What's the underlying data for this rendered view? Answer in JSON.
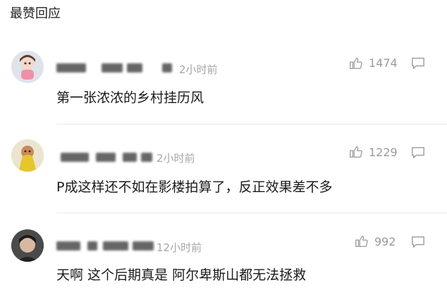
{
  "section": {
    "title": "最赞回应"
  },
  "comments": [
    {
      "time": "2小时前",
      "likes": "1474",
      "text": "第一张浓浓的乡村挂历风"
    },
    {
      "time": "2小时前",
      "likes": "1229",
      "text": "P成这样还不如在影楼拍算了，反正效果差不多"
    },
    {
      "time": "12小时前",
      "likes": "992",
      "text": "天啊 这个后期真是 阿尔卑斯山都无法拯救"
    }
  ],
  "icons": {
    "like": "thumbs-up-icon",
    "reply": "comment-bubble-icon"
  },
  "colors": {
    "muted": "#a6a6a6",
    "text": "#1a1a1a",
    "divider": "#e9e9e9"
  }
}
